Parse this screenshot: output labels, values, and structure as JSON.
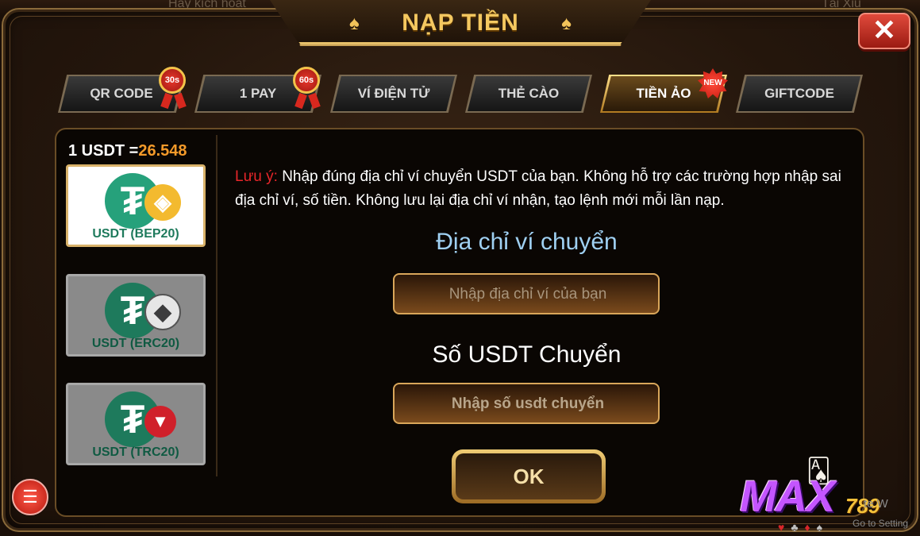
{
  "background": {
    "text_left": "Hãy kích hoạt",
    "text_right": "Tài Xỉu"
  },
  "dialog": {
    "title": "NẠP TIỀN",
    "close_label": "✕"
  },
  "tabs": [
    {
      "label": "QR CODE",
      "badge": "30s",
      "active": false
    },
    {
      "label": "1 PAY",
      "badge": "60s",
      "active": false
    },
    {
      "label": "VÍ ĐIỆN TỬ",
      "active": false
    },
    {
      "label": "THẺ CÀO",
      "active": false
    },
    {
      "label": "TIỀN ẢO",
      "badge": "NEW",
      "active": true
    },
    {
      "label": "GIFTCODE",
      "active": false
    }
  ],
  "rate": {
    "prefix": "1 USDT =",
    "value": "26.548"
  },
  "coins": [
    {
      "label": "USDT (BEP20)",
      "chain_icon": "binance-icon",
      "selected": true
    },
    {
      "label": "USDT (ERC20)",
      "chain_icon": "ethereum-icon",
      "selected": false
    },
    {
      "label": "USDT (TRC20)",
      "chain_icon": "tron-icon",
      "selected": false
    }
  ],
  "note": {
    "prefix": "Lưu ý:",
    "text": " Nhập đúng địa chỉ ví chuyển USDT của bạn. Không hỗ trợ các trường hợp nhập sai địa chỉ ví, số tiền. Không lưu lại địa chỉ ví nhận, tạo lệnh mới mỗi lần nạp."
  },
  "form": {
    "address_label": "Địa chỉ ví chuyển",
    "address_placeholder": "Nhập địa chỉ ví của bạn",
    "amount_label": "Số USDT Chuyển",
    "amount_placeholder": "Nhập số usdt chuyển",
    "submit_label": "OK"
  },
  "branding": {
    "logo_text": "MAX",
    "logo_number": "789"
  },
  "os_overlay": {
    "line1": "te W",
    "line2": "Go to Setting"
  },
  "colors": {
    "accent_gold": "#f4c860",
    "warning_red": "#e8262a",
    "label_blue": "#9fd0f2",
    "rate_orange": "#f49a2a"
  }
}
